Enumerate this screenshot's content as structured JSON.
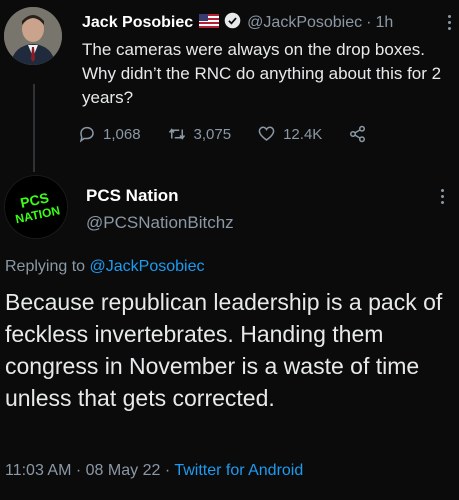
{
  "tweet1": {
    "author_name": "Jack Posobiec",
    "flag_icon": "us-flag-icon",
    "verified_icon": "verified-badge-icon",
    "handle": "@JackPosobiec",
    "separator": "·",
    "time": "1h",
    "text": "The cameras were always on the drop boxes. Why didn’t the RNC do anything about this for 2 years?",
    "replies": "1,068",
    "retweets": "3,075",
    "likes": "12.4K"
  },
  "tweet2": {
    "author_name": "PCS Nation",
    "avatar_text": "PCS NATION",
    "handle": "@PCSNationBitchz",
    "replying_to_label": "Replying to",
    "replying_to_handle": "@JackPosobiec",
    "text": "Because republican leadership is a pack of feckless invertebrates. Handing them congress in November is a waste of time unless that gets corrected.",
    "time": "11:03 AM",
    "date": "08 May 22",
    "source": "Twitter for Android",
    "separator": "·"
  },
  "colors": {
    "background": "#0b0b0b",
    "text": "#e7e9ea",
    "muted": "#8b98a5",
    "link": "#1d9bf0",
    "avatar_text": "#39ff14"
  }
}
